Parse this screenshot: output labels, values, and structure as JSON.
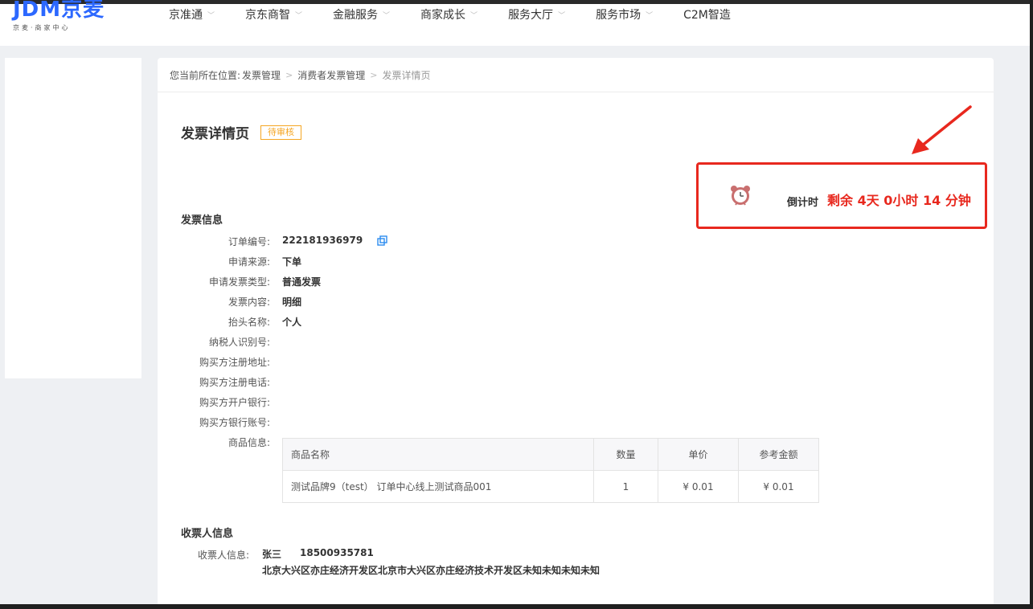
{
  "brand": {
    "logo_main": "JDM",
    "logo_cn": "京麦",
    "logo_sub": "京麦·商家中心"
  },
  "nav": [
    {
      "label": "京准通",
      "has_dropdown": true
    },
    {
      "label": "京东商智",
      "has_dropdown": true
    },
    {
      "label": "金融服务",
      "has_dropdown": true
    },
    {
      "label": "商家成长",
      "has_dropdown": true
    },
    {
      "label": "服务大厅",
      "has_dropdown": true
    },
    {
      "label": "服务市场",
      "has_dropdown": true
    },
    {
      "label": "C2M智造",
      "has_dropdown": false
    }
  ],
  "breadcrumb": {
    "prefix": "您当前所在位置:",
    "items": [
      "发票管理",
      "消费者发票管理",
      "发票详情页"
    ]
  },
  "page": {
    "title": "发票详情页",
    "status": "待审核"
  },
  "countdown": {
    "label": "倒计时",
    "value": "剩余 4天 0小时 14 分钟"
  },
  "invoice_section": {
    "title": "发票信息",
    "fields": [
      {
        "label": "订单编号:",
        "value": "222181936979"
      },
      {
        "label": "申请来源:",
        "value": "下单"
      },
      {
        "label": "申请发票类型:",
        "value": "普通发票"
      },
      {
        "label": "发票内容:",
        "value": "明细"
      },
      {
        "label": "抬头名称:",
        "value": "个人"
      },
      {
        "label": "纳税人识别号:",
        "value": ""
      },
      {
        "label": "购买方注册地址:",
        "value": ""
      },
      {
        "label": "购买方注册电话:",
        "value": ""
      },
      {
        "label": "购买方开户银行:",
        "value": ""
      },
      {
        "label": "购买方银行账号:",
        "value": ""
      }
    ],
    "goods_label": "商品信息:",
    "goods_table": {
      "headers": [
        "商品名称",
        "数量",
        "单价",
        "参考金额"
      ],
      "rows": [
        [
          "测试品牌9（test） 订单中心线上测试商品001",
          "1",
          "¥ 0.01",
          "¥ 0.01"
        ]
      ]
    }
  },
  "receiver_section": {
    "title": "收票人信息",
    "label": "收票人信息:",
    "name": "张三",
    "phone": "18500935781",
    "address": "北京大兴区亦庄经济开发区北京市大兴区亦庄经济技术开发区未知未知未知未知"
  },
  "colors": {
    "accent_red": "#e8281e",
    "badge_orange": "#f5a623",
    "brand_blue": "#2c68ff"
  }
}
